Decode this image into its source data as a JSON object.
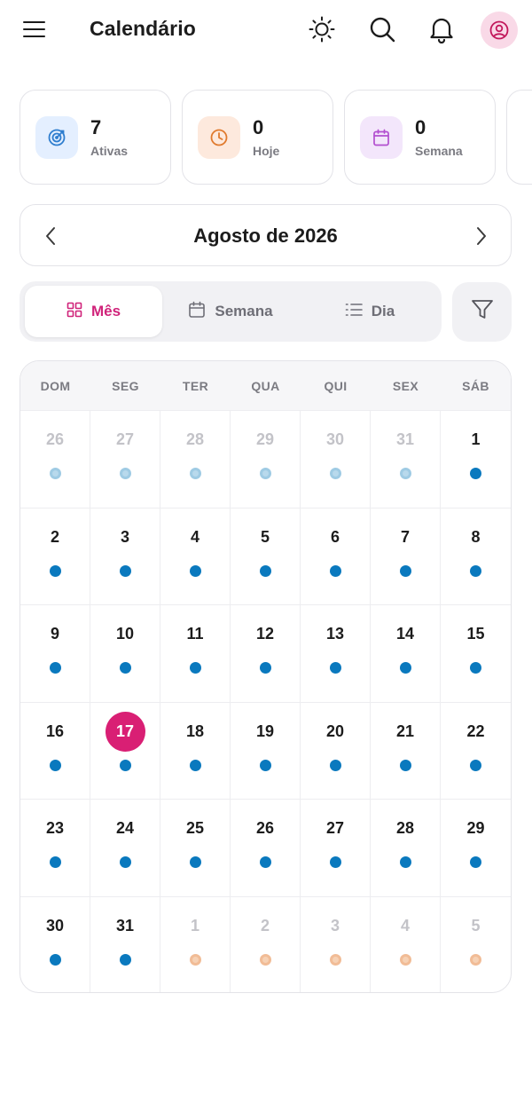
{
  "header": {
    "title": "Calendário",
    "icons": [
      "menu-icon",
      "sun-icon",
      "search-icon",
      "bell-icon",
      "user-circle-icon"
    ]
  },
  "stats": [
    {
      "value": "7",
      "label": "Ativas",
      "icon": "target-icon",
      "tint": "#e4efff",
      "color": "#2f7ecf"
    },
    {
      "value": "0",
      "label": "Hoje",
      "icon": "clock-icon",
      "tint": "#fde9dd",
      "color": "#e07a2e"
    },
    {
      "value": "0",
      "label": "Semana",
      "icon": "calendar-icon",
      "tint": "#f3e6fb",
      "color": "#b24fd0"
    }
  ],
  "month_nav": {
    "title": "Agosto de 2026"
  },
  "views": {
    "tabs": [
      {
        "label": "Mês",
        "icon": "grid-icon",
        "active": true
      },
      {
        "label": "Semana",
        "icon": "calendar-icon",
        "active": false
      },
      {
        "label": "Dia",
        "icon": "list-icon",
        "active": false
      }
    ]
  },
  "calendar": {
    "weekdays": [
      "DOM",
      "SEG",
      "TER",
      "QUA",
      "QUI",
      "SEX",
      "SÁB"
    ],
    "weeks": [
      [
        {
          "d": "26",
          "t": "prev"
        },
        {
          "d": "27",
          "t": "prev"
        },
        {
          "d": "28",
          "t": "prev"
        },
        {
          "d": "29",
          "t": "prev"
        },
        {
          "d": "30",
          "t": "prev"
        },
        {
          "d": "31",
          "t": "prev"
        },
        {
          "d": "1",
          "t": "cur"
        }
      ],
      [
        {
          "d": "2",
          "t": "cur"
        },
        {
          "d": "3",
          "t": "cur"
        },
        {
          "d": "4",
          "t": "cur"
        },
        {
          "d": "5",
          "t": "cur"
        },
        {
          "d": "6",
          "t": "cur"
        },
        {
          "d": "7",
          "t": "cur"
        },
        {
          "d": "8",
          "t": "cur"
        }
      ],
      [
        {
          "d": "9",
          "t": "cur"
        },
        {
          "d": "10",
          "t": "cur"
        },
        {
          "d": "11",
          "t": "cur"
        },
        {
          "d": "12",
          "t": "cur"
        },
        {
          "d": "13",
          "t": "cur"
        },
        {
          "d": "14",
          "t": "cur"
        },
        {
          "d": "15",
          "t": "cur"
        }
      ],
      [
        {
          "d": "16",
          "t": "cur"
        },
        {
          "d": "17",
          "t": "today"
        },
        {
          "d": "18",
          "t": "cur"
        },
        {
          "d": "19",
          "t": "cur"
        },
        {
          "d": "20",
          "t": "cur"
        },
        {
          "d": "21",
          "t": "cur"
        },
        {
          "d": "22",
          "t": "cur"
        }
      ],
      [
        {
          "d": "23",
          "t": "cur"
        },
        {
          "d": "24",
          "t": "cur"
        },
        {
          "d": "25",
          "t": "cur"
        },
        {
          "d": "26",
          "t": "cur"
        },
        {
          "d": "27",
          "t": "cur"
        },
        {
          "d": "28",
          "t": "cur"
        },
        {
          "d": "29",
          "t": "cur"
        }
      ],
      [
        {
          "d": "30",
          "t": "cur"
        },
        {
          "d": "31",
          "t": "cur"
        },
        {
          "d": "1",
          "t": "next"
        },
        {
          "d": "2",
          "t": "next"
        },
        {
          "d": "3",
          "t": "next"
        },
        {
          "d": "4",
          "t": "next"
        },
        {
          "d": "5",
          "t": "next"
        }
      ]
    ]
  },
  "colors": {
    "accent": "#d91f74",
    "event_dot": "#0a79be"
  }
}
